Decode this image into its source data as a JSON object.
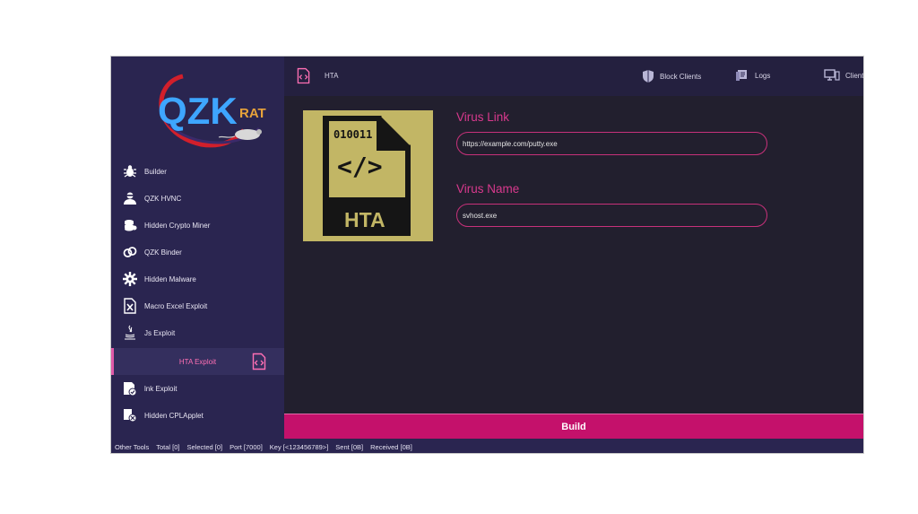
{
  "sidebar": {
    "logo_text": "QZK",
    "logo_sub": "RAT",
    "items": [
      {
        "label": "Builder",
        "icon": "bug-icon"
      },
      {
        "label": "QZK HVNC",
        "icon": "user-icon"
      },
      {
        "label": "Hidden Crypto Miner",
        "icon": "coins-icon"
      },
      {
        "label": "QZK Binder",
        "icon": "link-icon"
      },
      {
        "label": "Hidden Malware",
        "icon": "gear-icon"
      },
      {
        "label": "Macro Excel Exploit",
        "icon": "excel-icon"
      },
      {
        "label": "Js Exploit",
        "icon": "java-icon"
      },
      {
        "label": "HTA Exploit",
        "icon": "code-file-icon"
      },
      {
        "label": "lnk Exploit",
        "icon": "shortcut-icon"
      },
      {
        "label": "Hidden CPLApplet",
        "icon": "applet-icon"
      }
    ],
    "active_index": 7
  },
  "topbar": {
    "page_title": "HTA",
    "block_clients": "Block Clients",
    "logs": "Logs",
    "clients": "Clients"
  },
  "content": {
    "image_top_text": "010011",
    "image_symbol": "</>",
    "image_bottom_text": "HTA",
    "virus_link_label": "Virus Link",
    "virus_link_value": "https://example.com/putty.exe",
    "virus_name_label": "Virus Name",
    "virus_name_value": "svhost.exe",
    "build_label": "Build"
  },
  "statusbar": {
    "other_tools": "Other Tools",
    "total": "Total [0]",
    "selected": "Selected [0]",
    "port": "Port [7000]",
    "key": "Key [<123456789>]",
    "sent": "Sent [0B]",
    "received": "Received [0B]"
  },
  "colors": {
    "sidebar_bg": "#2a2550",
    "content_bg": "#221f2e",
    "accent_pink": "#c4116b",
    "label_pink": "#d8398d",
    "image_bg": "#c2b665"
  }
}
